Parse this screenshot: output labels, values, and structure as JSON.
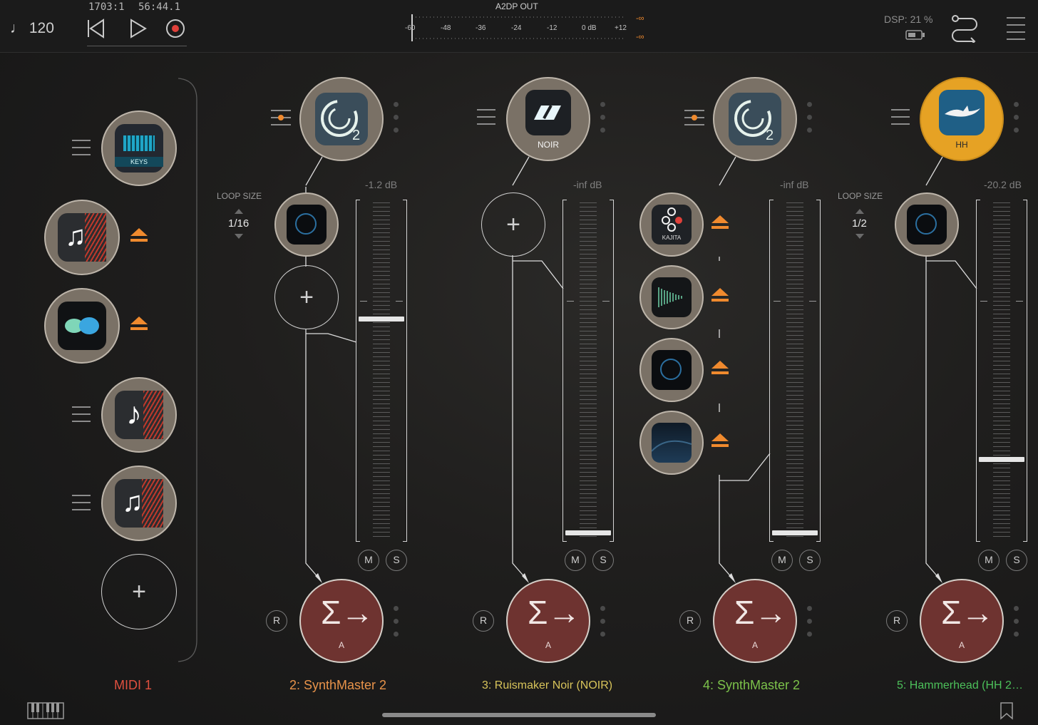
{
  "topbar": {
    "tempo": "♩ 120",
    "position_bars": "1703:1",
    "position_time": "56:44.1",
    "meter_title": "A2DP OUT",
    "meter_ticks": [
      "-60",
      "-48",
      "-36",
      "-24",
      "-12",
      "0 dB",
      "+12"
    ],
    "peak_left": "-∞",
    "peak_right": "-∞",
    "dsp": "DSP: 21 %",
    "accent_color": "#f08a2e"
  },
  "midi_column": {
    "plugins": [
      {
        "label": "KEYS",
        "icon": "keys-icon"
      },
      {
        "icon": "music-notes-icon"
      },
      {
        "icon": "infinity-blob-icon"
      },
      {
        "icon": "music-note-icon"
      },
      {
        "icon": "music-notes-icon"
      }
    ],
    "name": "MIDI 1",
    "name_color": "#e0503f"
  },
  "strips": [
    {
      "name": "2: SynthMaster 2",
      "name_color": "#e8934a",
      "instrument_label": "",
      "db": "-1.2 dB",
      "fader_level_pct": 65,
      "loop_size_label": "LOOP SIZE",
      "loop_size": "1/16"
    },
    {
      "name": "3: Ruismaker Noir (NOIR)",
      "name_color": "#d8c45a",
      "instrument_label": "NOIR",
      "db": "-inf dB",
      "fader_level_pct": 1
    },
    {
      "name": "4: SynthMaster 2",
      "name_color": "#7cc24a",
      "instrument_label": "",
      "db": "-inf dB",
      "fader_level_pct": 1,
      "fx_labels": [
        "KAJITA"
      ]
    },
    {
      "name": "5: Hammerhead (HH 2…",
      "name_color": "#4cc05a",
      "instrument_label": "HH",
      "db": "-20.2 dB",
      "fader_level_pct": 23,
      "loop_size_label": "LOOP SIZE",
      "loop_size": "1/2"
    }
  ],
  "buttons": {
    "mute": "M",
    "solo": "S",
    "record": "R",
    "bus": "A"
  }
}
